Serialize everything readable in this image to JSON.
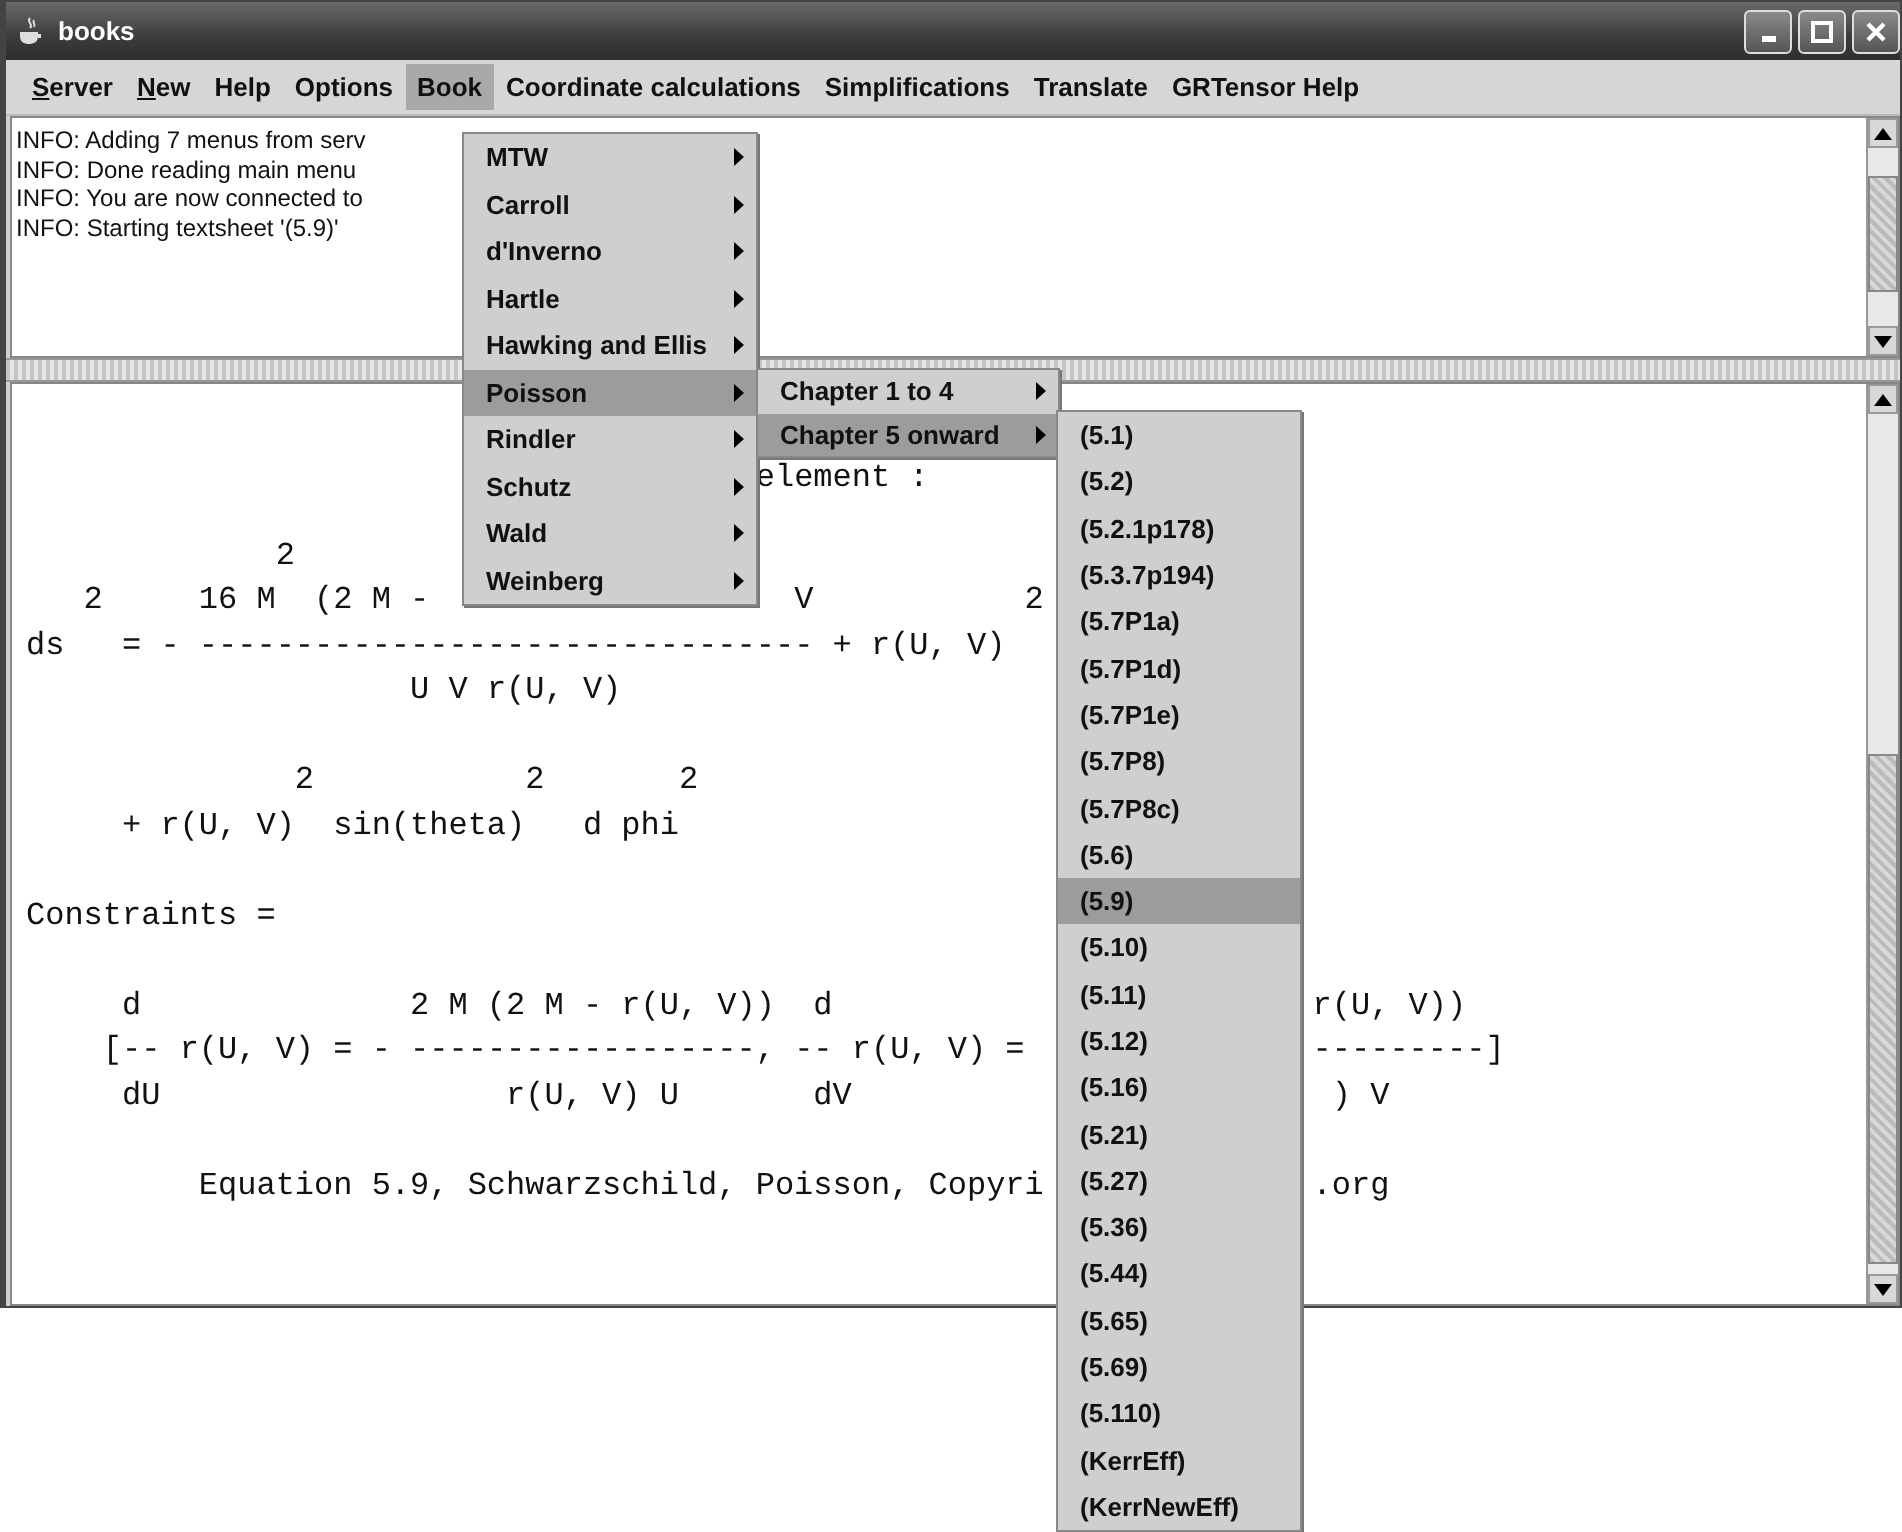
{
  "window": {
    "title": "books"
  },
  "menu_bar": [
    {
      "label": "Server",
      "mnemonic_underlined": true,
      "selected": false
    },
    {
      "label": "New",
      "mnemonic_underlined": true,
      "selected": false
    },
    {
      "label": "Help",
      "mnemonic_underlined": false,
      "selected": false
    },
    {
      "label": "Options",
      "mnemonic_underlined": false,
      "selected": false
    },
    {
      "label": "Book",
      "mnemonic_underlined": false,
      "selected": true
    },
    {
      "label": "Coordinate calculations",
      "mnemonic_underlined": false,
      "selected": false
    },
    {
      "label": "Simplifications",
      "mnemonic_underlined": false,
      "selected": false
    },
    {
      "label": "Translate",
      "mnemonic_underlined": false,
      "selected": false
    },
    {
      "label": "GRTensor Help",
      "mnemonic_underlined": false,
      "selected": false
    }
  ],
  "info_log": {
    "lines": [
      "INFO: Adding 7 menus from serv",
      "INFO: Done reading main menu",
      "INFO: You are now connected to",
      "INFO: Starting textsheet '(5.9)'"
    ]
  },
  "worksheet": {
    "lines": [
      {
        "segments": [
          "element :"
        ]
      },
      {
        "segments": [
          "2"
        ]
      },
      {
        "segments": [
          "2     16 M  (2 M -",
          "V",
          "2"
        ]
      },
      {
        "segments": [
          "ds   = - -------------------------------- + r(U, V)"
        ]
      },
      {
        "segments": [
          "U V r(U, V)"
        ]
      },
      {
        "segments": [
          "2           2       2"
        ]
      },
      {
        "segments": [
          "+ r(U, V)  sin(theta)   d phi"
        ]
      },
      {
        "segments": [
          "Constraints ="
        ]
      },
      {
        "segments": [
          "d              2 M (2 M - r(U, V))  d",
          "r(U, V))"
        ]
      },
      {
        "segments": [
          "[-- r(U, V) = - ------------------, -- r(U, V) =",
          "---------]"
        ]
      },
      {
        "segments": [
          "dU                  r(U, V) U       dV",
          ") V"
        ]
      },
      {
        "segments": [
          "Equation 5.9, Schwarzschild, Poisson, Copyri",
          ".org"
        ]
      }
    ]
  },
  "book_menu": {
    "items": [
      {
        "label": "MTW",
        "selected": false
      },
      {
        "label": "Carroll",
        "selected": false
      },
      {
        "label": "d'Inverno",
        "selected": false
      },
      {
        "label": "Hartle",
        "selected": false
      },
      {
        "label": "Hawking and Ellis",
        "selected": false
      },
      {
        "label": "Poisson",
        "selected": true
      },
      {
        "label": "Rindler",
        "selected": false
      },
      {
        "label": "Schutz",
        "selected": false
      },
      {
        "label": "Wald",
        "selected": false
      },
      {
        "label": "Weinberg",
        "selected": false
      }
    ]
  },
  "chapter_menu": {
    "items": [
      {
        "label": "Chapter 1 to 4",
        "selected": false
      },
      {
        "label": "Chapter 5 onward",
        "selected": true
      }
    ]
  },
  "equation_menu": {
    "items": [
      {
        "label": "(5.1)",
        "selected": false
      },
      {
        "label": "(5.2)",
        "selected": false
      },
      {
        "label": "(5.2.1p178)",
        "selected": false
      },
      {
        "label": "(5.3.7p194)",
        "selected": false
      },
      {
        "label": "(5.7P1a)",
        "selected": false
      },
      {
        "label": "(5.7P1d)",
        "selected": false
      },
      {
        "label": "(5.7P1e)",
        "selected": false
      },
      {
        "label": "(5.7P8)",
        "selected": false
      },
      {
        "label": "(5.7P8c)",
        "selected": false
      },
      {
        "label": "(5.6)",
        "selected": false
      },
      {
        "label": "(5.9)",
        "selected": true
      },
      {
        "label": "(5.10)",
        "selected": false
      },
      {
        "label": "(5.11)",
        "selected": false
      },
      {
        "label": "(5.12)",
        "selected": false
      },
      {
        "label": "(5.16)",
        "selected": false
      },
      {
        "label": "(5.21)",
        "selected": false
      },
      {
        "label": "(5.27)",
        "selected": false
      },
      {
        "label": "(5.36)",
        "selected": false
      },
      {
        "label": "(5.44)",
        "selected": false
      },
      {
        "label": "(5.65)",
        "selected": false
      },
      {
        "label": "(5.69)",
        "selected": false
      },
      {
        "label": "(5.110)",
        "selected": false
      },
      {
        "label": "(KerrEff)",
        "selected": false
      },
      {
        "label": "(KerrNewEff)",
        "selected": false
      }
    ]
  }
}
